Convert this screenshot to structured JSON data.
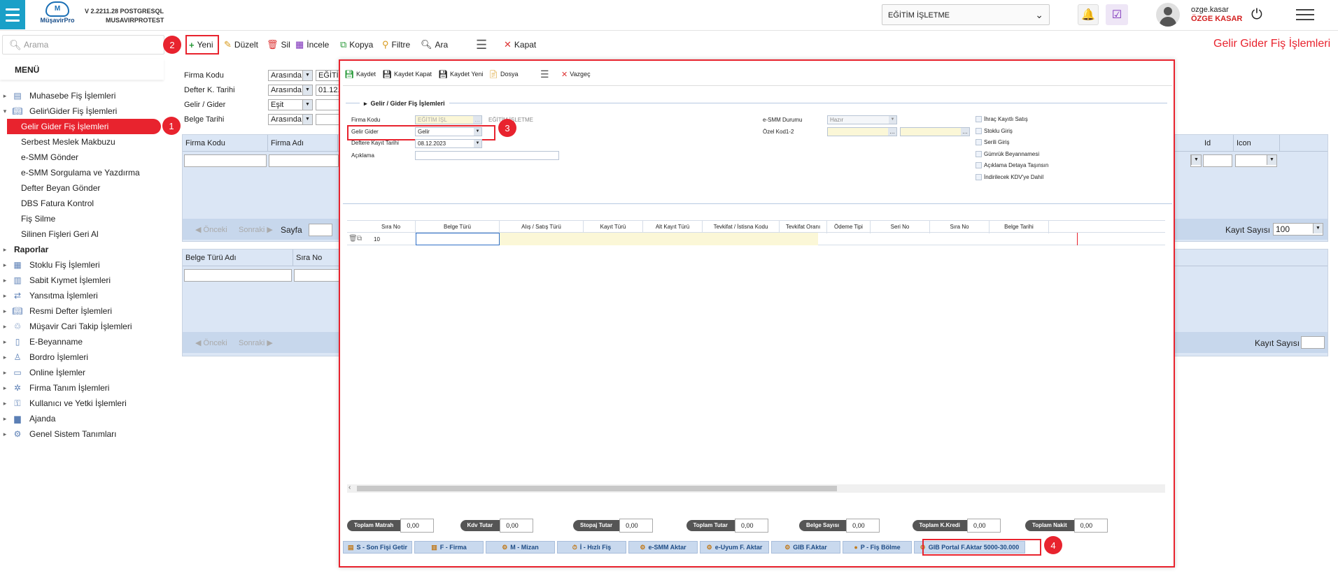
{
  "header": {
    "version": "V 2.2211.28 POSTGRESQL",
    "db": "MUSAVIRPROTEST",
    "logo_text": "MüşavirPro",
    "company": "EĞİTİM İŞLETME",
    "user": "ozge.kasar",
    "user_display": "ÖZGE KASAR"
  },
  "search": {
    "placeholder": "Arama"
  },
  "menu": {
    "title": "MENÜ",
    "items": [
      {
        "label": "Muhasebe Fiş İşlemleri",
        "icon": "receipt-icon"
      },
      {
        "label": "Gelir\\Gider Fiş İşlemleri",
        "icon": "book-icon"
      },
      {
        "label": "Gelir Gider Fiş İşlemleri",
        "sub": true,
        "active": true
      },
      {
        "label": "Serbest Meslek Makbuzu",
        "sub": true
      },
      {
        "label": "e-SMM Gönder",
        "sub": true
      },
      {
        "label": "e-SMM Sorgulama ve Yazdırma",
        "sub": true
      },
      {
        "label": "Defter Beyan Gönder",
        "sub": true
      },
      {
        "label": "DBS Fatura Kontrol",
        "sub": true
      },
      {
        "label": "Fiş Silme",
        "sub": true
      },
      {
        "label": "Silinen Fişleri Geri Al",
        "sub": true
      },
      {
        "label": "Raporlar",
        "bold": true
      },
      {
        "label": "Stoklu Fiş İşlemleri",
        "icon": "boxes-icon"
      },
      {
        "label": "Sabit Kıymet İşlemleri",
        "icon": "building-icon"
      },
      {
        "label": "Yansıtma İşlemleri",
        "icon": "transfer-icon"
      },
      {
        "label": "Resmi Defter İşlemleri",
        "icon": "ledger-icon"
      },
      {
        "label": "Müşavir Cari Takip İşlemleri",
        "icon": "handshake-icon"
      },
      {
        "label": "E-Beyanname",
        "icon": "phone-doc-icon"
      },
      {
        "label": "Bordro İşlemleri",
        "icon": "person-icon"
      },
      {
        "label": "Online İşlemler",
        "icon": "window-icon"
      },
      {
        "label": "Firma Tanım İşlemleri",
        "icon": "gear-network-icon"
      },
      {
        "label": "Kullanıcı ve Yetki İşlemleri",
        "icon": "key-icon"
      },
      {
        "label": "Ajanda",
        "icon": "folder-icon"
      },
      {
        "label": "Genel Sistem Tanımları",
        "icon": "gear-icon"
      }
    ]
  },
  "toolbar": {
    "new": "Yeni",
    "edit": "Düzelt",
    "delete": "Sil",
    "inspect": "İncele",
    "copy": "Kopya",
    "filter": "Filtre",
    "find": "Ara",
    "close": "Kapat"
  },
  "page_title": "Gelir Gider Fiş İşlemleri",
  "filters": [
    {
      "label": "Firma Kodu",
      "op": "Arasında",
      "val": "EĞİTİM"
    },
    {
      "label": "Defter K. Tarihi",
      "op": "Arasında",
      "val": "01.12."
    },
    {
      "label": "Gelir / Gider",
      "op": "Eşit",
      "val": ""
    },
    {
      "label": "Belge Tarihi",
      "op": "Arasında",
      "val": ""
    }
  ],
  "grid1": {
    "cols": [
      "Firma Kodu",
      "Firma Adı"
    ],
    "right_cols": [
      "Id",
      "Icon"
    ],
    "prev": "Önceki",
    "next": "Sonraki",
    "page": "Sayfa",
    "count_label": "Kayıt Sayısı",
    "count": "100"
  },
  "grid2": {
    "cols": [
      "Belge Türü Adı",
      "Sıra No"
    ],
    "prev": "Önceki",
    "next": "Sonraki",
    "count_label": "Kayıt Sayısı"
  },
  "modal": {
    "toolbar": {
      "save": "Kaydet",
      "save_close": "Kaydet Kapat",
      "save_new": "Kaydet Yeni",
      "file": "Dosya",
      "cancel": "Vazgeç"
    },
    "section": "Gelir / Gider Fiş İşlemleri",
    "fields": {
      "firma_kodu_label": "Firma Kodu",
      "firma_kodu": "EĞİTİM İŞL",
      "firma_adi": "EĞİTİM İŞLETME",
      "gelir_gider_label": "Gelir Gider",
      "gelir_gider": "Gelir",
      "tarih_label": "Deftere Kayıt Tarihi",
      "tarih": "08.12.2023",
      "aciklama_label": "Açıklama",
      "esmm_label": "e-SMM Durumu",
      "esmm": "Hazır",
      "ozel_label": "Özel Kod1-2"
    },
    "checks": [
      "İhraç Kayıtlı Satış",
      "Stoklu Giriş",
      "Serili Giriş",
      "Gümrük Beyannamesi",
      "Açıklama Detaya Taşınsın",
      "İndirilecek KDV'ye Dahil"
    ],
    "detail_cols": [
      "Sıra No",
      "Belge Türü",
      "Alış / Satış Türü",
      "Kayıt Türü",
      "Alt Kayıt Türü",
      "Tevkifat / İstisna Kodu",
      "Tevkifat Oranı",
      "Ödeme Tipi",
      "Seri No",
      "Sıra No",
      "Belge Tarihi"
    ],
    "row_sira": "10",
    "totals": [
      {
        "label": "Toplam Matrah",
        "value": "0,00"
      },
      {
        "label": "Kdv Tutar",
        "value": "0,00"
      },
      {
        "label": "Stopaj Tutar",
        "value": "0,00"
      },
      {
        "label": "Toplam Tutar",
        "value": "0,00"
      },
      {
        "label": "Belge Sayısı",
        "value": "0,00"
      },
      {
        "label": "Toplam K.Kredi",
        "value": "0,00"
      },
      {
        "label": "Toplam Nakit",
        "value": "0,00"
      }
    ],
    "buttons": [
      "S - Son Fişi Getir",
      "F - Firma",
      "M - Mizan",
      "İ - Hızlı Fiş",
      "e-SMM Aktar",
      "e-Uyum F. Aktar",
      "GIB F.Aktar",
      "P - Fiş Bölme",
      "GIB Portal F.Aktar 5000-30.000"
    ]
  },
  "badges": [
    "1",
    "2",
    "3",
    "4"
  ],
  "colors": {
    "accent": "#e8232e",
    "brand": "#1aa0c8"
  }
}
